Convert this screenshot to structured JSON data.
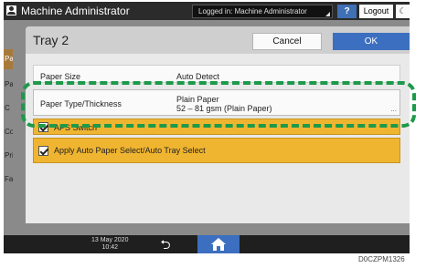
{
  "topbar": {
    "user_icon": "user-icon",
    "title": "Machine Administrator",
    "logged_in": "Logged in: Machine Administrator",
    "help_label": "?",
    "logout_label": "Logout",
    "sleep_label": "☾"
  },
  "background_tabs": [
    "Pap",
    "Pa",
    "C",
    "Cop",
    "Prin",
    "Fax"
  ],
  "dialog": {
    "title": "Tray 2",
    "cancel_label": "Cancel",
    "ok_label": "OK",
    "rows": {
      "paper_size": {
        "label": "Paper Size",
        "value": "Auto Detect"
      },
      "paper_type": {
        "label": "Paper Type/Thickness",
        "value_line1": "Plain Paper",
        "value_line2": "52 – 81 gsm (Plain Paper)",
        "more": "..."
      }
    },
    "checks": {
      "apd": {
        "label": "APS Switch",
        "checked": true
      },
      "auto_select": {
        "label": "Apply Auto Paper Select/Auto Tray Select",
        "checked": true
      }
    }
  },
  "bottombar": {
    "date": "13 May 2020",
    "time": "10:42",
    "back_icon": "back-arrow-icon",
    "home_icon": "home-icon"
  },
  "caption": "D0CZPM1326",
  "colors": {
    "highlight": "#1c9a4a",
    "ok_button": "#3c6fbf",
    "check_row": "#f0b530"
  }
}
